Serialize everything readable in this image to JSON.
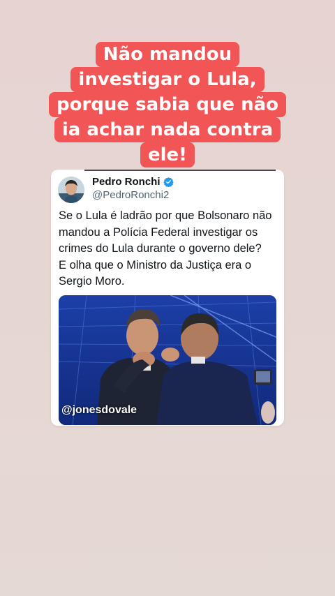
{
  "caption": {
    "lines": [
      "Não mandou",
      "investigar o Lula,",
      "porque sabia que não",
      "ia achar nada contra",
      "ele!"
    ]
  },
  "tweet": {
    "author_name": "Pedro Ronchi",
    "author_handle": "@PedroRonchi2",
    "verified_icon": "verified-badge-icon",
    "text_lines": [
      "Se o Lula é ladrão por que Bolsonaro não",
      "mandou a Polícia Federal investigar os",
      "crimes do Lula durante o governo dele?",
      "E olha que o Ministro da Justiça era o",
      "Sergio Moro."
    ],
    "media": {
      "watermark": "@jonesdovale"
    }
  },
  "colors": {
    "caption_bg": "#f25555",
    "verified_blue": "#1d9bf0",
    "text_dark": "#0f1419",
    "text_muted": "#536471"
  }
}
